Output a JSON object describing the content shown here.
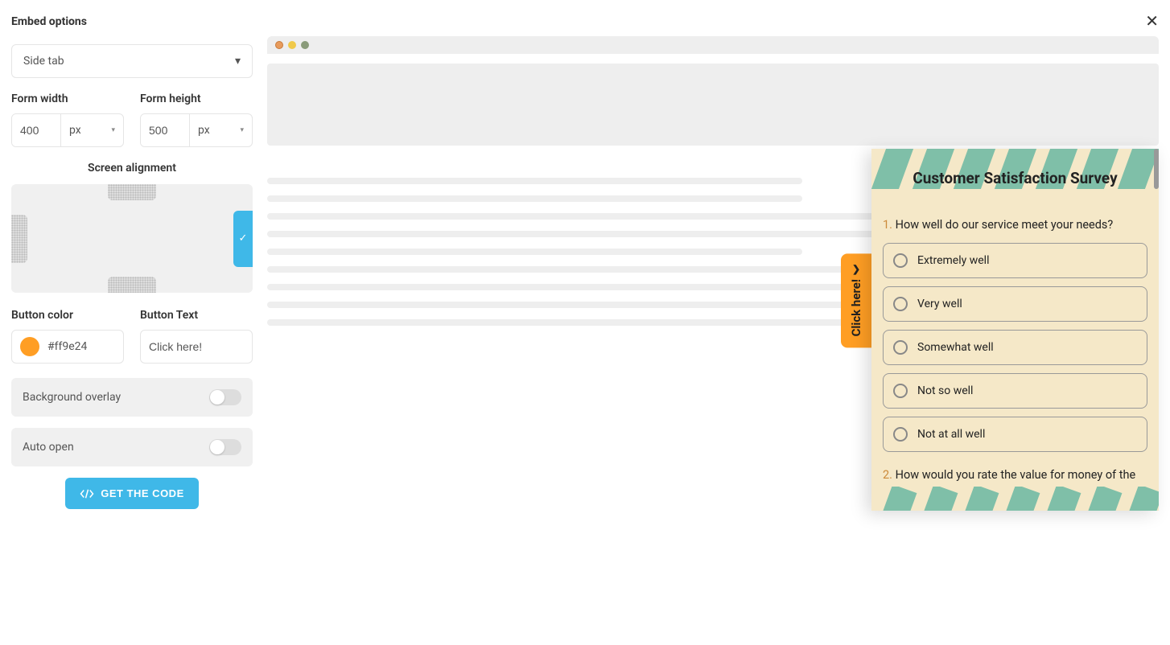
{
  "header": {
    "title": "Embed options"
  },
  "embed_type": {
    "selected": "Side tab"
  },
  "form_width": {
    "label": "Form width",
    "value": "400",
    "unit": "px"
  },
  "form_height": {
    "label": "Form height",
    "value": "500",
    "unit": "px"
  },
  "alignment": {
    "label": "Screen alignment",
    "selected": "right"
  },
  "button_color": {
    "label": "Button color",
    "value": "#ff9e24"
  },
  "button_text": {
    "label": "Button Text",
    "value": "Click here!"
  },
  "toggles": {
    "background_overlay": {
      "label": "Background overlay",
      "on": false
    },
    "auto_open": {
      "label": "Auto open",
      "on": false
    }
  },
  "get_code_btn": "GET THE CODE",
  "side_tab_label": "Click here!",
  "survey": {
    "title": "Customer Satisfaction Survey",
    "q1": {
      "num": "1.",
      "text": "How well do our service meet your needs?"
    },
    "options": [
      "Extremely well",
      "Very well",
      "Somewhat well",
      "Not so well",
      "Not at all well"
    ],
    "q2": {
      "num": "2.",
      "text": "How would you rate the value for money of the"
    }
  }
}
